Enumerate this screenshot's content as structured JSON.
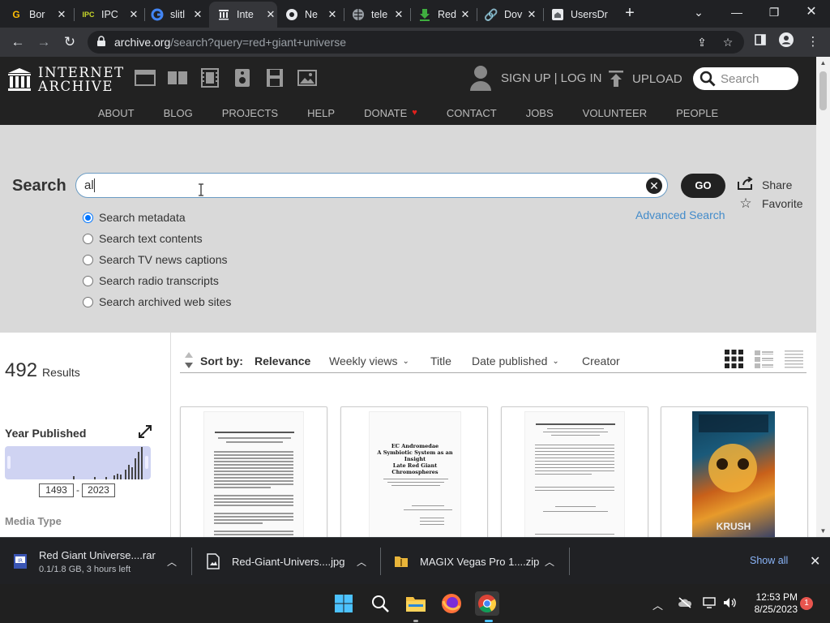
{
  "browser": {
    "tabs": [
      {
        "label": "Bor",
        "icon": "google-icon",
        "active": false
      },
      {
        "label": "IPC",
        "icon": "ipc-icon",
        "active": false
      },
      {
        "label": "slitl",
        "icon": "google-icon",
        "active": false
      },
      {
        "label": "Inte",
        "icon": "archive-icon",
        "active": true
      },
      {
        "label": "Ne",
        "icon": "chrome-icon",
        "active": false
      },
      {
        "label": "tele",
        "icon": "globe-icon",
        "active": false
      },
      {
        "label": "Red",
        "icon": "download-icon",
        "active": false
      },
      {
        "label": "Dov",
        "icon": "link-icon",
        "active": false
      },
      {
        "label": "UsersDr",
        "icon": "home-icon",
        "active": false
      }
    ],
    "url_domain": "archive.org",
    "url_path": "/search?query=red+giant+universe"
  },
  "ia": {
    "logo_line1": "INTERNET",
    "logo_line2": "ARCHIVE",
    "sign_in": "SIGN UP | LOG IN",
    "upload": "UPLOAD",
    "search_placeholder": "Search",
    "nav": [
      {
        "label": "ABOUT"
      },
      {
        "label": "BLOG"
      },
      {
        "label": "PROJECTS"
      },
      {
        "label": "HELP"
      },
      {
        "label": "DONATE"
      },
      {
        "label": "CONTACT"
      },
      {
        "label": "JOBS"
      },
      {
        "label": "VOLUNTEER"
      },
      {
        "label": "PEOPLE"
      }
    ]
  },
  "search": {
    "label": "Search",
    "value": "al",
    "go": "GO",
    "share": "Share",
    "favorite": "Favorite",
    "advanced": "Advanced Search",
    "options": [
      {
        "label": "Search metadata",
        "checked": true
      },
      {
        "label": "Search text contents",
        "checked": false
      },
      {
        "label": "Search TV news captions",
        "checked": false
      },
      {
        "label": "Search radio transcripts",
        "checked": false
      },
      {
        "label": "Search archived web sites",
        "checked": false
      }
    ]
  },
  "results": {
    "count": "492",
    "count_label": "Results",
    "year_published": "Year Published",
    "year_from": "1493",
    "year_to": "2023",
    "media_type": "Media Type",
    "sort_by": "Sort by:",
    "sorts": [
      "Relevance",
      "Weekly views",
      "Title",
      "Date published",
      "Creator"
    ],
    "cards": [
      {
        "kind": "paper",
        "title": ""
      },
      {
        "kind": "paper",
        "title": "EC Andromedae\nA Symbiotic System as an Insight\nLate Red Giant Chromospheres"
      },
      {
        "kind": "paper",
        "title": ""
      },
      {
        "kind": "comic",
        "title": "KRUSH"
      }
    ]
  },
  "downloads": {
    "items": [
      {
        "name": "Red Giant Universe....rar",
        "sub": "0.1/1.8 GB, 3 hours left"
      },
      {
        "name": "Red-Giant-Univers....jpg",
        "sub": ""
      },
      {
        "name": "MAGIX Vegas Pro 1....zip",
        "sub": ""
      }
    ],
    "show_all": "Show all"
  },
  "taskbar": {
    "time": "12:53 PM",
    "date": "8/25/2023",
    "notifications": "1"
  }
}
